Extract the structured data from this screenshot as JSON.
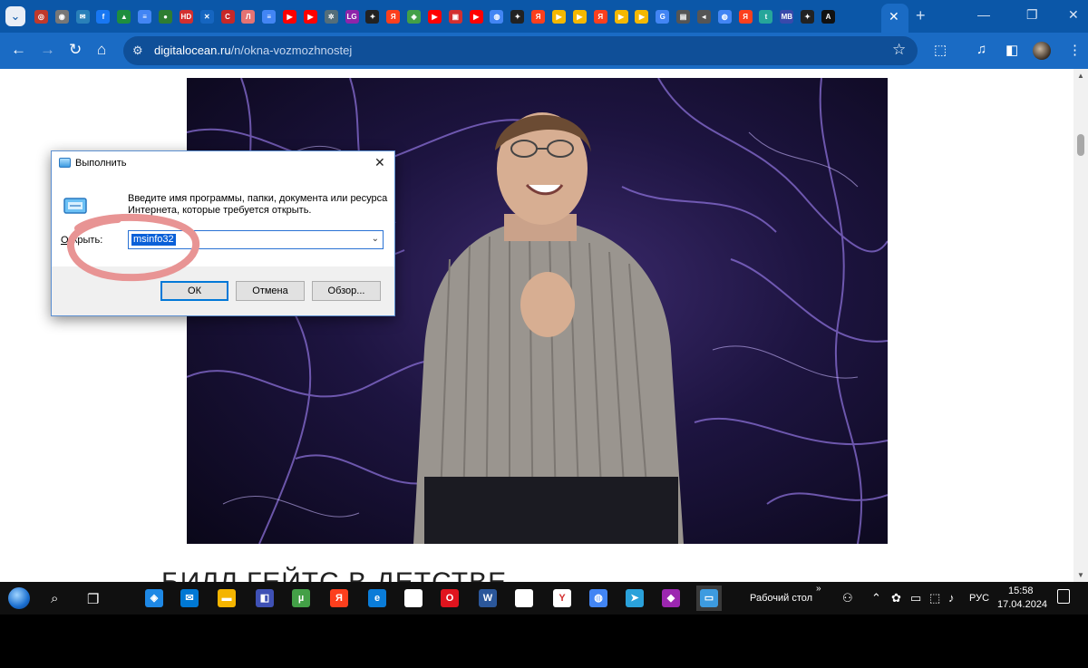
{
  "browser": {
    "tab_favicons": [
      {
        "icon": "tab-icon-1",
        "color": "#c0392b",
        "glyph": "◎"
      },
      {
        "icon": "tab-icon-2",
        "color": "#777777",
        "glyph": "◉"
      },
      {
        "icon": "tab-icon-3",
        "color": "#2980b9",
        "glyph": "✉"
      },
      {
        "icon": "tab-icon-4",
        "color": "#1877f2",
        "glyph": "f"
      },
      {
        "icon": "tab-icon-5",
        "color": "#1e8e3e",
        "glyph": "▲"
      },
      {
        "icon": "tab-icon-6",
        "color": "#4285f4",
        "glyph": "≡"
      },
      {
        "icon": "tab-icon-7",
        "color": "#2e7d32",
        "glyph": "●"
      },
      {
        "icon": "tab-icon-8",
        "color": "#d32f2f",
        "glyph": "HD"
      },
      {
        "icon": "tab-icon-9",
        "color": "#1565c0",
        "glyph": "✕"
      },
      {
        "icon": "tab-icon-10",
        "color": "#c62828",
        "glyph": "C"
      },
      {
        "icon": "tab-icon-11",
        "color": "#e57373",
        "glyph": "Л"
      },
      {
        "icon": "tab-icon-12",
        "color": "#4285f4",
        "glyph": "≡"
      },
      {
        "icon": "tab-icon-13",
        "color": "#ff0000",
        "glyph": "▶"
      },
      {
        "icon": "tab-icon-14",
        "color": "#ff0000",
        "glyph": "▶"
      },
      {
        "icon": "tab-icon-15",
        "color": "#546e7a",
        "glyph": "✲"
      },
      {
        "icon": "tab-icon-16",
        "color": "#8e24aa",
        "glyph": "LG"
      },
      {
        "icon": "tab-icon-17",
        "color": "#222222",
        "glyph": "✦"
      },
      {
        "icon": "tab-icon-18",
        "color": "#fc3f1d",
        "glyph": "Я"
      },
      {
        "icon": "tab-icon-19",
        "color": "#43a047",
        "glyph": "◈"
      },
      {
        "icon": "tab-icon-20",
        "color": "#ff0000",
        "glyph": "▶"
      },
      {
        "icon": "tab-icon-21",
        "color": "#d32f2f",
        "glyph": "▣"
      },
      {
        "icon": "tab-icon-22",
        "color": "#ff0000",
        "glyph": "▶"
      },
      {
        "icon": "tab-icon-23",
        "color": "#4285f4",
        "glyph": "◍"
      },
      {
        "icon": "tab-icon-24",
        "color": "#222222",
        "glyph": "✦"
      },
      {
        "icon": "tab-icon-25",
        "color": "#fc3f1d",
        "glyph": "Я"
      },
      {
        "icon": "tab-icon-26",
        "color": "#f5b800",
        "glyph": "▶"
      },
      {
        "icon": "tab-icon-27",
        "color": "#f5b800",
        "glyph": "▶"
      },
      {
        "icon": "tab-icon-28",
        "color": "#fc3f1d",
        "glyph": "Я"
      },
      {
        "icon": "tab-icon-29",
        "color": "#f5b800",
        "glyph": "▶"
      },
      {
        "icon": "tab-icon-30",
        "color": "#f5b800",
        "glyph": "▶"
      },
      {
        "icon": "tab-icon-31",
        "color": "#4285f4",
        "glyph": "G"
      },
      {
        "icon": "tab-icon-32",
        "color": "#555555",
        "glyph": "▤"
      },
      {
        "icon": "tab-icon-33",
        "color": "#555555",
        "glyph": "◂"
      },
      {
        "icon": "tab-icon-34",
        "color": "#4285f4",
        "glyph": "◍"
      },
      {
        "icon": "tab-icon-35",
        "color": "#fc3f1d",
        "glyph": "Я"
      },
      {
        "icon": "tab-icon-36",
        "color": "#26a69a",
        "glyph": "t"
      },
      {
        "icon": "tab-icon-37",
        "color": "#3949ab",
        "glyph": "MB"
      },
      {
        "icon": "tab-icon-38",
        "color": "#222222",
        "glyph": "✦"
      },
      {
        "icon": "tab-icon-39",
        "color": "#111111",
        "glyph": "A"
      }
    ],
    "url_host": "digitalocean.ru",
    "url_path": "/n/okna-vozmozhnostej"
  },
  "page": {
    "heading": "БИЛЛ ГЕЙТС В ДЕТСТВЕ"
  },
  "run_dialog": {
    "title": "Выполнить",
    "description": "Введите имя программы, папки, документа или ресурса Интернета, которые требуется открыть.",
    "open_label_accel": "О",
    "open_label_rest": "ткрыть:",
    "input_value": "msinfo32",
    "ok_label": "ОК",
    "cancel_label": "Отмена",
    "browse_label": "Обзор...",
    "annotation_color": "#e89494"
  },
  "taskbar": {
    "apps": [
      {
        "name": "taskbar-app-defender",
        "color": "#1e88e5",
        "glyph": "◈"
      },
      {
        "name": "taskbar-app-mail",
        "color": "#0078d4",
        "glyph": "✉"
      },
      {
        "name": "taskbar-app-explorer",
        "color": "#f4b400",
        "glyph": "▬"
      },
      {
        "name": "taskbar-app-remote",
        "color": "#3f51b5",
        "glyph": "◧"
      },
      {
        "name": "taskbar-app-utorrent",
        "color": "#43a047",
        "glyph": "µ"
      },
      {
        "name": "taskbar-app-yandex",
        "color": "#fc3f1d",
        "glyph": "Я"
      },
      {
        "name": "taskbar-app-edge",
        "color": "#0a7cd8",
        "glyph": "e"
      },
      {
        "name": "taskbar-app-document",
        "color": "#ffffff",
        "glyph": ""
      },
      {
        "name": "taskbar-app-opera",
        "color": "#e0141e",
        "glyph": "O"
      },
      {
        "name": "taskbar-app-word",
        "color": "#2b579a",
        "glyph": "W"
      },
      {
        "name": "taskbar-app-document-2",
        "color": "#ffffff",
        "glyph": ""
      },
      {
        "name": "taskbar-app-yandex-browser",
        "color": "#ffffff",
        "glyph": "Y"
      },
      {
        "name": "taskbar-app-chrome",
        "color": "#4285f4",
        "glyph": "◍"
      },
      {
        "name": "taskbar-app-telegram",
        "color": "#2aa1da",
        "glyph": "➤"
      },
      {
        "name": "taskbar-app-drop",
        "color": "#9c27b0",
        "glyph": "◆"
      },
      {
        "name": "taskbar-app-run",
        "color": "#3d9be0",
        "glyph": "▭"
      }
    ],
    "desktop_label": "Рабочий стол",
    "language": "РУС",
    "time": "15:58",
    "date": "17.04.2024"
  }
}
